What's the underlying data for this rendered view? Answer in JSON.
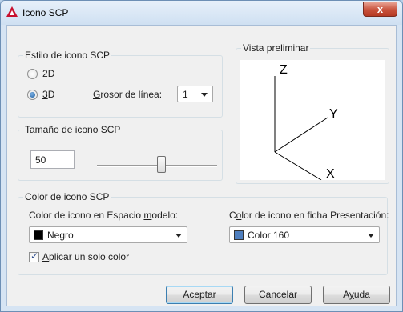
{
  "window": {
    "title": "Icono SCP",
    "close_label": "x"
  },
  "style_group": {
    "label": "Estilo de icono SCP",
    "radio_2d": {
      "label_prefix": "",
      "label_accel": "2",
      "label_rest": "D",
      "checked": false
    },
    "radio_3d": {
      "label_prefix": "",
      "label_accel": "3",
      "label_rest": "D",
      "checked": true
    },
    "line_weight": {
      "label_accel": "G",
      "label_rest": "rosor de línea:",
      "value": "1"
    }
  },
  "size_group": {
    "label": "Tamaño de icono SCP",
    "value": "50",
    "slider_fraction": 0.5
  },
  "preview": {
    "label": "Vista preliminar",
    "axes": {
      "x": "X",
      "y": "Y",
      "z": "Z"
    }
  },
  "color_group": {
    "label": "Color de icono SCP",
    "model_space": {
      "label_prefix": "Color de icono en Espacio ",
      "label_accel": "m",
      "label_rest": "odelo:",
      "value": "Negro",
      "swatch": "#000000"
    },
    "layout_tab": {
      "label_prefix": "C",
      "label_accel": "o",
      "label_rest": "lor de icono en ficha Presentación:",
      "value": "Color 160",
      "swatch": "#4f7fbf"
    },
    "single_color": {
      "label_accel": "A",
      "label_rest": "plicar un solo color",
      "checked": true
    }
  },
  "buttons": {
    "ok": "Aceptar",
    "cancel": "Cancelar",
    "help_accel": "y",
    "help_prefix": "A",
    "help_rest": "uda"
  }
}
